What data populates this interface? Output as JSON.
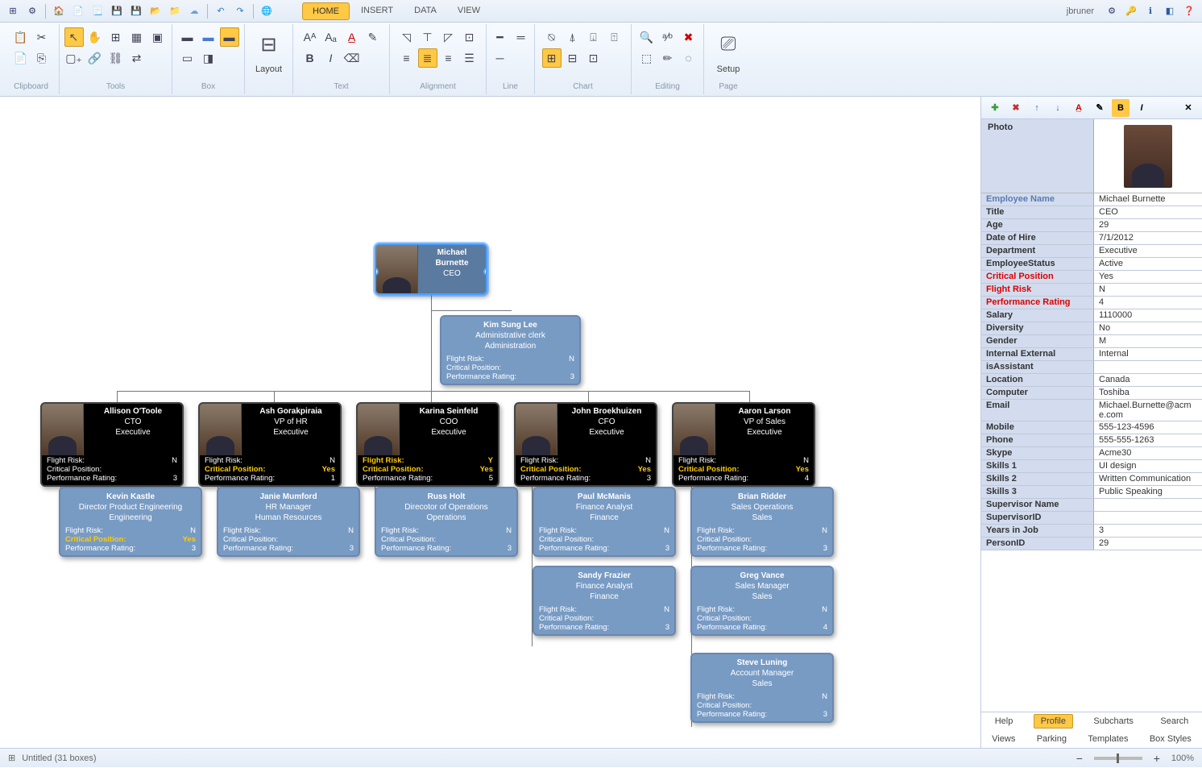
{
  "user": "jbruner",
  "tabs": {
    "home": "HOME",
    "insert": "INSERT",
    "data": "DATA",
    "view": "VIEW"
  },
  "ribbon": {
    "clipboard": "Clipboard",
    "tools": "Tools",
    "box": "Box",
    "layout": "Layout",
    "text": "Text",
    "alignment": "Alignment",
    "line": "Line",
    "chart": "Chart",
    "editing": "Editing",
    "page": "Page",
    "setup": "Setup"
  },
  "status": {
    "doc": "Untitled (31 boxes)",
    "zoom": "100%"
  },
  "side": {
    "photo_label": "Photo",
    "fields": [
      {
        "k": "Employee Name",
        "v": "Michael Burnette",
        "cls": "sel"
      },
      {
        "k": "Title",
        "v": "CEO"
      },
      {
        "k": "Age",
        "v": "29"
      },
      {
        "k": "Date of Hire",
        "v": "7/1/2012"
      },
      {
        "k": "Department",
        "v": "Executive"
      },
      {
        "k": "EmployeeStatus",
        "v": "Active"
      },
      {
        "k": "Critical Position",
        "v": "Yes",
        "cls": "red"
      },
      {
        "k": "Flight Risk",
        "v": "N",
        "cls": "red"
      },
      {
        "k": "Performance Rating",
        "v": "4",
        "cls": "red"
      },
      {
        "k": "Salary",
        "v": "1110000"
      },
      {
        "k": "Diversity",
        "v": "No"
      },
      {
        "k": "Gender",
        "v": "M"
      },
      {
        "k": "Internal External",
        "v": "Internal"
      },
      {
        "k": "isAssistant",
        "v": ""
      },
      {
        "k": "Location",
        "v": "Canada"
      },
      {
        "k": "Computer",
        "v": "Toshiba"
      },
      {
        "k": "Email",
        "v": "Michael.Burnette@acme.com"
      },
      {
        "k": "Mobile",
        "v": "555-123-4596"
      },
      {
        "k": "Phone",
        "v": "555-555-1263"
      },
      {
        "k": "Skype",
        "v": "Acme30"
      },
      {
        "k": "Skills 1",
        "v": "UI design"
      },
      {
        "k": "Skills 2",
        "v": "Written Communication"
      },
      {
        "k": "Skills 3",
        "v": "Public Speaking"
      },
      {
        "k": "Supervisor Name",
        "v": ""
      },
      {
        "k": "SupervisorID",
        "v": ""
      },
      {
        "k": "Years in Job",
        "v": "3"
      },
      {
        "k": "PersonID",
        "v": "29"
      }
    ],
    "tabs": {
      "help": "Help",
      "profile": "Profile",
      "subcharts": "Subcharts",
      "search": "Search",
      "views": "Views",
      "parking": "Parking",
      "templates": "Templates",
      "boxstyles": "Box Styles"
    }
  },
  "labels": {
    "fr": "Flight Risk:",
    "cp": "Critical Position:",
    "pr": "Performance Rating:"
  },
  "nodes": {
    "ceo": {
      "name": "Michael Burnette",
      "title": "CEO",
      "dept": ""
    },
    "kim": {
      "name": "Kim Sung Lee",
      "title": "Administrative clerk",
      "dept": "Administration",
      "fr": "N",
      "cp": "",
      "pr": "3"
    },
    "cto": {
      "name": "Allison O'Toole",
      "title": "CTO",
      "dept": "Executive",
      "fr": "N",
      "cp": "",
      "pr": "3"
    },
    "vphr": {
      "name": "Ash Gorakpiraia",
      "title": "VP of HR",
      "dept": "Executive",
      "fr": "N",
      "cp": "Yes",
      "pr": "1"
    },
    "coo": {
      "name": "Karina Seinfeld",
      "title": "COO",
      "dept": "Executive",
      "fr": "Y",
      "cp": "Yes",
      "pr": "5"
    },
    "cfo": {
      "name": "John Broekhuizen",
      "title": "CFO",
      "dept": "Executive",
      "fr": "N",
      "cp": "Yes",
      "pr": "3"
    },
    "vps": {
      "name": "Aaron Larson",
      "title": "VP of Sales",
      "dept": "Executive",
      "fr": "N",
      "cp": "Yes",
      "pr": "4"
    },
    "kevin": {
      "name": "Kevin Kastle",
      "title": "Director Product Engineering",
      "dept": "Engineering",
      "fr": "N",
      "cp": "Yes",
      "pr": "3"
    },
    "janie": {
      "name": "Janie Mumford",
      "title": "HR Manager",
      "dept": "Human Resources",
      "fr": "N",
      "cp": "",
      "pr": "3"
    },
    "russ": {
      "name": "Russ Holt",
      "title": "Direcotor of Operations",
      "dept": "Operations",
      "fr": "N",
      "cp": "",
      "pr": "3"
    },
    "paul": {
      "name": "Paul McManis",
      "title": "Finance Analyst",
      "dept": "Finance",
      "fr": "N",
      "cp": "",
      "pr": "3"
    },
    "brian": {
      "name": "Brian Ridder",
      "title": "Sales Operations",
      "dept": "Sales",
      "fr": "N",
      "cp": "",
      "pr": "3"
    },
    "sandy": {
      "name": "Sandy Frazier",
      "title": "Finance Analyst",
      "dept": "Finance",
      "fr": "N",
      "cp": "",
      "pr": "3"
    },
    "greg": {
      "name": "Greg Vance",
      "title": "Sales Manager",
      "dept": "Sales",
      "fr": "N",
      "cp": "",
      "pr": "4"
    },
    "steve": {
      "name": "Steve Luning",
      "title": "Account Manager",
      "dept": "Sales",
      "fr": "N",
      "cp": "",
      "pr": "3"
    }
  }
}
